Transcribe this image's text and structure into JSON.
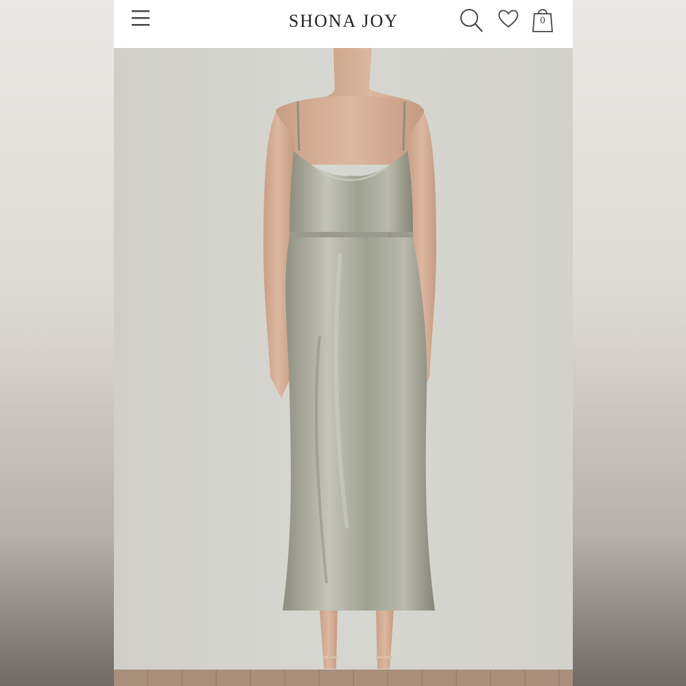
{
  "header": {
    "brand": "SHONA JOY",
    "menu_icon": "hamburger-menu-icon",
    "search_icon": "search-icon",
    "wishlist_icon": "heart-icon",
    "bag_icon": "shopping-bag-icon",
    "bag_count": "0"
  },
  "product": {
    "image": "model-wearing-sage-satin-cowl-neck-slip-dress",
    "dress_color": "#a8a99a"
  }
}
